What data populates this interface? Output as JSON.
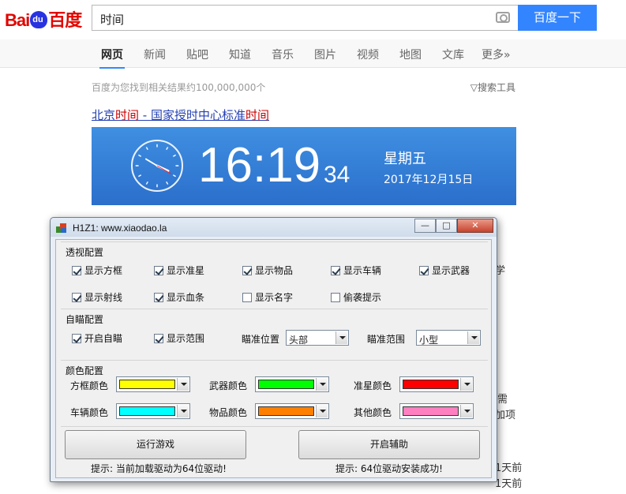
{
  "baidu": {
    "logo_left": "Bai",
    "logo_paw": "du",
    "logo_right": "百度",
    "search_value": "时间",
    "search_button": "百度一下",
    "tabs": [
      "网页",
      "新闻",
      "贴吧",
      "知道",
      "音乐",
      "图片",
      "视频",
      "地图",
      "文库",
      "更多»"
    ],
    "result_count": "百度为您找到相关结果约100,000,000个",
    "search_tools": "▽搜索工具",
    "result_title_parts": [
      "北京",
      "时间",
      " - 国家授时中心标准",
      "时间"
    ],
    "clock": {
      "time": "16:19",
      "seconds": "34",
      "weekday": "星期五",
      "date": "2017年12月15日"
    },
    "bg_fragments": {
      "learn": "学",
      "need": "需",
      "item": "加项",
      "days_ago": "1天前"
    }
  },
  "dialog": {
    "title": "H1Z1: www.xiaodao.la",
    "window_buttons": {
      "minimize": "—",
      "maximize": "□",
      "close": "✕"
    },
    "esp": {
      "title": "透视配置",
      "options": [
        {
          "label": "显示方框",
          "checked": true
        },
        {
          "label": "显示准星",
          "checked": true
        },
        {
          "label": "显示物品",
          "checked": true
        },
        {
          "label": "显示车辆",
          "checked": true
        },
        {
          "label": "显示武器",
          "checked": true
        },
        {
          "label": "显示射线",
          "checked": true
        },
        {
          "label": "显示血条",
          "checked": true
        },
        {
          "label": "显示名字",
          "checked": false
        },
        {
          "label": "偷袭提示",
          "checked": false
        }
      ]
    },
    "aim": {
      "title": "自瞄配置",
      "options": [
        {
          "label": "开启自瞄",
          "checked": true
        },
        {
          "label": "显示范围",
          "checked": true
        }
      ],
      "position_label": "瞄准位置",
      "position_value": "头部",
      "range_label": "瞄准范围",
      "range_value": "小型"
    },
    "colors": {
      "title": "颜色配置",
      "items": [
        {
          "label": "方框颜色",
          "color": "#ffff00"
        },
        {
          "label": "武器颜色",
          "color": "#00ff00"
        },
        {
          "label": "准星颜色",
          "color": "#ff0000"
        },
        {
          "label": "车辆颜色",
          "color": "#00ffff"
        },
        {
          "label": "物品颜色",
          "color": "#ff8000"
        },
        {
          "label": "其他颜色",
          "color": "#ff80c0"
        }
      ]
    },
    "run_button": "运行游戏",
    "assist_button": "开启辅助",
    "tip_left": "提示: 当前加载驱动为64位驱动!",
    "tip_right": "提示: 64位驱动安装成功!"
  }
}
